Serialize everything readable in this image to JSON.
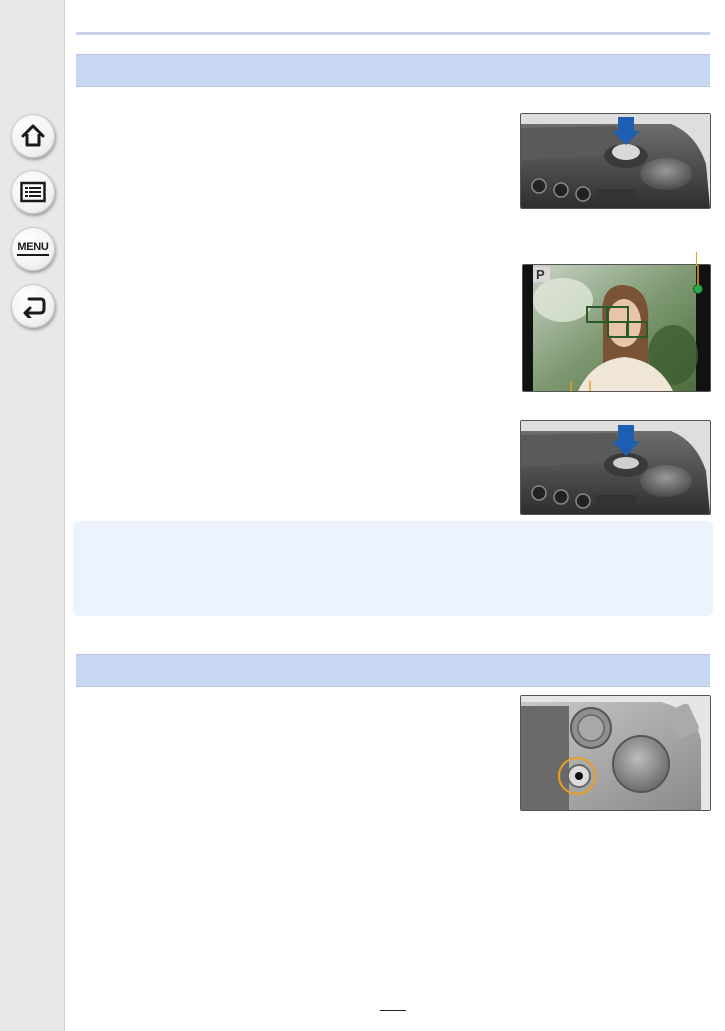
{
  "nav": {
    "home_icon": "home-icon",
    "contents_icon": "list-icon",
    "menu_label": "MENU",
    "back_icon": "back-arrow-icon"
  },
  "viewfinder": {
    "mode_badge": "P"
  },
  "colors": {
    "section_bar": "#c9d8f2",
    "note_box": "#edf3fc",
    "focus_indicator": "#2aa84a",
    "callout": "#e8a020",
    "shutter_arrow": "#1f5fb3"
  }
}
